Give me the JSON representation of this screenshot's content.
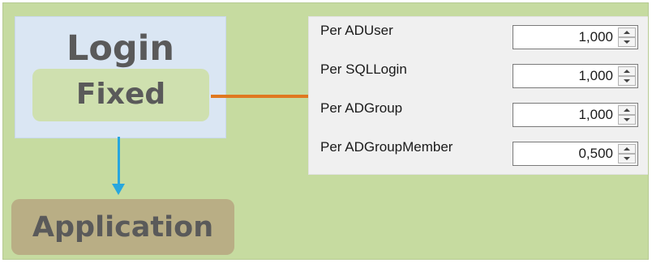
{
  "diagram": {
    "login_title": "Login",
    "fixed_label": "Fixed",
    "application_label": "Application"
  },
  "settings": {
    "rows": [
      {
        "label": "Per ADUser",
        "value": "1,000"
      },
      {
        "label": "Per SQLLogin",
        "value": "1,000"
      },
      {
        "label": "Per ADGroup",
        "value": "1,000"
      },
      {
        "label": "Per ADGroupMember",
        "value": "0,500"
      }
    ]
  },
  "colors": {
    "background": "#c6dba0",
    "login_box": "#dae6f3",
    "fixed_box": "#cfe0af",
    "application_box": "#b9ae85",
    "connector": "#e07820",
    "arrow": "#27a7de",
    "panel": "#f0f0f0"
  },
  "icons": {
    "spin_up": "spin-up-icon",
    "spin_down": "spin-down-icon",
    "arrow": "down-arrow-icon"
  }
}
